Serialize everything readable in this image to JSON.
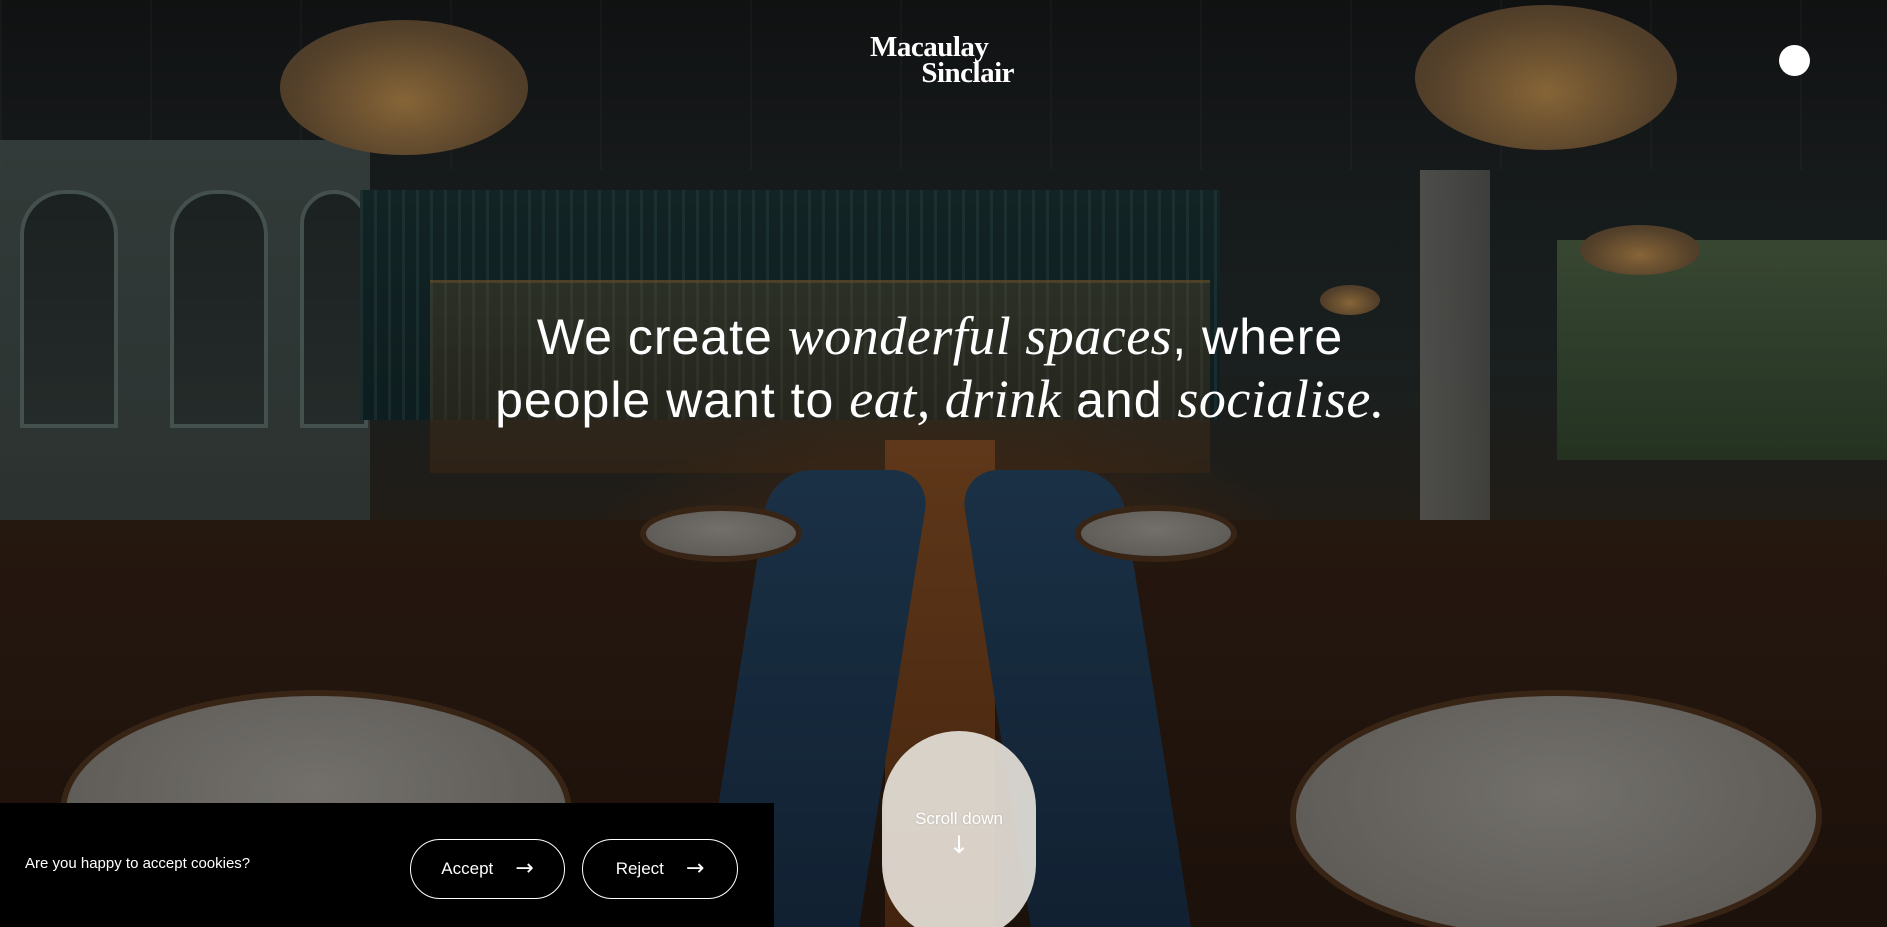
{
  "header": {
    "logo_line1": "Macaulay",
    "logo_line2": "Sinclair",
    "menu_icon": "menu-dot-icon"
  },
  "hero": {
    "headline_part1": "We create ",
    "headline_em1": "wonderful spaces",
    "headline_part2": ", where people want to ",
    "headline_em2": "eat, drink",
    "headline_part3": " and ",
    "headline_em3": "socialise.",
    "scroll_label": "Scroll down",
    "scroll_arrow": "↓"
  },
  "cookie_banner": {
    "question": "Are you happy to accept cookies?",
    "accept_label": "Accept",
    "reject_label": "Reject",
    "arrow": "→"
  },
  "colors": {
    "text": "#ffffff",
    "banner_bg": "#000000",
    "scroll_pill_bg": "#e9e4dd"
  }
}
